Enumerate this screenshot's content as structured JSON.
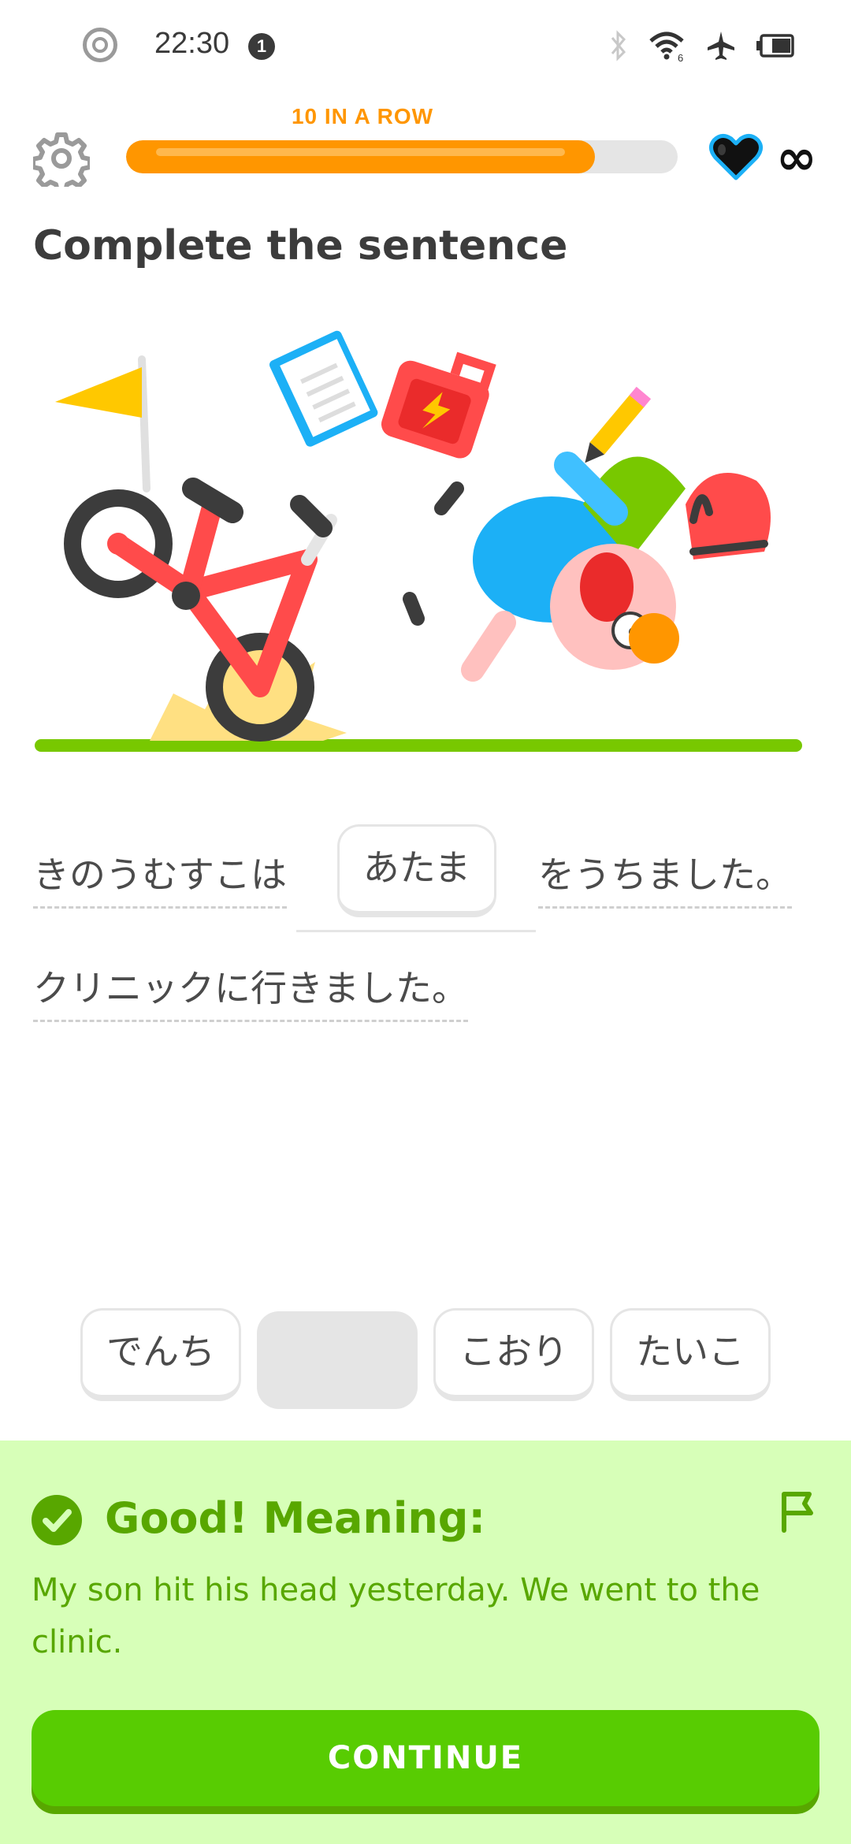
{
  "status_bar": {
    "time": "22:30",
    "notification_count": "1",
    "wifi_badge": "6",
    "icons": [
      "record-icon",
      "bluetooth-icon",
      "wifi-icon",
      "airplane-icon",
      "battery-icon"
    ]
  },
  "header": {
    "streak_label": "10 IN A ROW",
    "progress": 0.85,
    "hearts_label": "∞",
    "colors": {
      "streak": "#ff9600",
      "heart_outline": "#1cb0f6"
    }
  },
  "exercise": {
    "title": "Complete the sentence",
    "sentence_prefix": "きのうむすこは",
    "selected_answer": "あたま",
    "sentence_suffix": "をうちました。",
    "sentence_line2": "クリニックに行きました。"
  },
  "word_bank": {
    "options": [
      {
        "label": "でんち"
      },
      {
        "label": ""
      },
      {
        "label": "こおり"
      },
      {
        "label": "たいこ"
      }
    ]
  },
  "feedback": {
    "title": "Good! Meaning:",
    "translation": "My son hit his head yesterday. We went to the clinic.",
    "colors": {
      "background": "#d7ffb8",
      "text": "#58a700"
    }
  },
  "continue_button": {
    "label": "CONTINUE",
    "color": "#58cc02"
  }
}
